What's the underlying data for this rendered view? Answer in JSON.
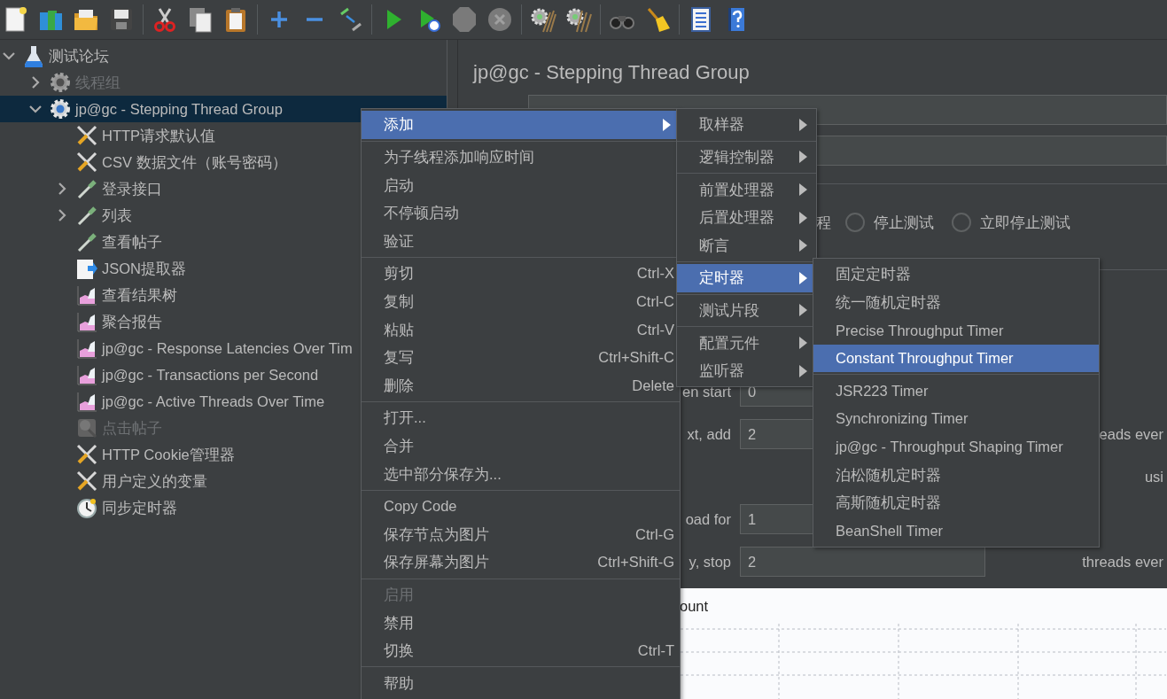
{
  "toolbar": [
    {
      "kind": "new",
      "enabled": true
    },
    {
      "kind": "templates",
      "enabled": true
    },
    {
      "kind": "open",
      "enabled": true
    },
    {
      "kind": "save",
      "enabled": true
    },
    {
      "kind": "separator"
    },
    {
      "kind": "cut",
      "enabled": true
    },
    {
      "kind": "copy",
      "enabled": true
    },
    {
      "kind": "paste",
      "enabled": true
    },
    {
      "kind": "separator"
    },
    {
      "kind": "expand",
      "enabled": true
    },
    {
      "kind": "collapse",
      "enabled": true
    },
    {
      "kind": "toggle",
      "enabled": true
    },
    {
      "kind": "separator"
    },
    {
      "kind": "start",
      "enabled": true
    },
    {
      "kind": "start_no_pause",
      "enabled": true
    },
    {
      "kind": "stop",
      "enabled": false
    },
    {
      "kind": "shutdown",
      "enabled": false
    },
    {
      "kind": "separator"
    },
    {
      "kind": "clear",
      "enabled": true
    },
    {
      "kind": "clear_all",
      "enabled": true
    },
    {
      "kind": "separator"
    },
    {
      "kind": "search",
      "enabled": true
    },
    {
      "kind": "reset",
      "enabled": true
    },
    {
      "kind": "separator"
    },
    {
      "kind": "functions",
      "enabled": true
    },
    {
      "kind": "help",
      "enabled": true
    }
  ],
  "tree": [
    {
      "label": "测试论坛",
      "kind": "test_plan",
      "expanded": true,
      "enabled": true,
      "selected": false,
      "children": [
        {
          "label": "线程组",
          "kind": "thread_group",
          "expanded": false,
          "enabled": false,
          "selected": false
        },
        {
          "label": "jp@gc - Stepping Thread Group",
          "kind": "thread_group",
          "expanded": true,
          "enabled": true,
          "selected": true,
          "children": [
            {
              "label": "HTTP请求默认值",
              "kind": "config",
              "enabled": true,
              "selected": false
            },
            {
              "label": "CSV 数据文件（账号密码）",
              "kind": "config",
              "enabled": true,
              "selected": false
            },
            {
              "label": "登录接口",
              "kind": "sampler",
              "expanded": false,
              "enabled": true,
              "selected": false
            },
            {
              "label": "列表",
              "kind": "sampler",
              "expanded": false,
              "enabled": true,
              "selected": false
            },
            {
              "label": "查看帖子",
              "kind": "sampler",
              "enabled": true,
              "selected": false
            },
            {
              "label": "JSON提取器",
              "kind": "extractor",
              "enabled": true,
              "selected": false
            },
            {
              "label": "查看结果树",
              "kind": "listener",
              "enabled": true,
              "selected": false
            },
            {
              "label": "聚合报告",
              "kind": "listener",
              "enabled": true,
              "selected": false
            },
            {
              "label": "jp@gc - Response Latencies Over Tim",
              "kind": "listener",
              "enabled": true,
              "selected": false
            },
            {
              "label": "jp@gc - Transactions per Second",
              "kind": "listener",
              "enabled": true,
              "selected": false
            },
            {
              "label": "jp@gc - Active Threads Over Time",
              "kind": "listener",
              "enabled": true,
              "selected": false
            },
            {
              "label": "点击帖子",
              "kind": "debug",
              "enabled": false,
              "selected": false
            },
            {
              "label": "HTTP Cookie管理器",
              "kind": "config",
              "enabled": true,
              "selected": false
            },
            {
              "label": "用户定义的变量",
              "kind": "config",
              "enabled": true,
              "selected": false
            },
            {
              "label": "同步定时器",
              "kind": "timer",
              "enabled": true,
              "selected": false
            }
          ]
        }
      ]
    }
  ],
  "panel": {
    "title": "jp@gc - Stepping Thread Group",
    "radio_fragment": "程",
    "radios": [
      {
        "label": "停止测试",
        "selected": false
      },
      {
        "label": "立即停止测试",
        "selected": false
      }
    ],
    "rows": [
      {
        "label": "en start",
        "value": "0"
      },
      {
        "label": "xt, add",
        "value": "2",
        "trailing": "eads ever"
      },
      {
        "trailing": "usi"
      },
      {
        "label": "oad for",
        "value": "1"
      },
      {
        "label": "y, stop",
        "value": "2",
        "trailing": "threads ever"
      }
    ],
    "chart_title": "ount"
  },
  "context_menu": {
    "items": [
      {
        "label": "添加",
        "kind": "submenu",
        "enabled": true,
        "selected": true
      },
      {
        "kind": "separator"
      },
      {
        "label": "为子线程添加响应时间",
        "kind": "item",
        "enabled": true,
        "selected": false
      },
      {
        "label": "启动",
        "kind": "item",
        "enabled": true,
        "selected": false
      },
      {
        "label": "不停顿启动",
        "kind": "item",
        "enabled": true,
        "selected": false
      },
      {
        "label": "验证",
        "kind": "item",
        "enabled": true,
        "selected": false
      },
      {
        "kind": "separator"
      },
      {
        "label": "剪切",
        "shortcut": "Ctrl-X",
        "kind": "item",
        "enabled": true,
        "selected": false
      },
      {
        "label": "复制",
        "shortcut": "Ctrl-C",
        "kind": "item",
        "enabled": true,
        "selected": false
      },
      {
        "label": "粘贴",
        "shortcut": "Ctrl-V",
        "kind": "item",
        "enabled": true,
        "selected": false
      },
      {
        "label": "复写",
        "shortcut": "Ctrl+Shift-C",
        "kind": "item",
        "enabled": true,
        "selected": false
      },
      {
        "label": "删除",
        "shortcut": "Delete",
        "kind": "item",
        "enabled": true,
        "selected": false
      },
      {
        "kind": "separator"
      },
      {
        "label": "打开...",
        "kind": "item",
        "enabled": true,
        "selected": false
      },
      {
        "label": "合并",
        "kind": "item",
        "enabled": true,
        "selected": false
      },
      {
        "label": "选中部分保存为...",
        "kind": "item",
        "enabled": true,
        "selected": false
      },
      {
        "kind": "separator"
      },
      {
        "label": "Copy Code",
        "kind": "item",
        "enabled": true,
        "selected": false
      },
      {
        "label": "保存节点为图片",
        "shortcut": "Ctrl-G",
        "kind": "item",
        "enabled": true,
        "selected": false
      },
      {
        "label": "保存屏幕为图片",
        "shortcut": "Ctrl+Shift-G",
        "kind": "item",
        "enabled": true,
        "selected": false
      },
      {
        "kind": "separator"
      },
      {
        "label": "启用",
        "kind": "item",
        "enabled": false,
        "selected": false
      },
      {
        "label": "禁用",
        "kind": "item",
        "enabled": true,
        "selected": false
      },
      {
        "label": "切换",
        "shortcut": "Ctrl-T",
        "kind": "item",
        "enabled": true,
        "selected": false
      },
      {
        "kind": "separator"
      },
      {
        "label": "帮助",
        "kind": "item",
        "enabled": true,
        "selected": false
      }
    ]
  },
  "add_submenu": {
    "items": [
      {
        "label": "取样器",
        "kind": "submenu",
        "enabled": true,
        "selected": false
      },
      {
        "kind": "separator"
      },
      {
        "label": "逻辑控制器",
        "kind": "submenu",
        "enabled": true,
        "selected": false
      },
      {
        "kind": "separator"
      },
      {
        "label": "前置处理器",
        "kind": "submenu",
        "enabled": true,
        "selected": false
      },
      {
        "label": "后置处理器",
        "kind": "submenu",
        "enabled": true,
        "selected": false
      },
      {
        "label": "断言",
        "kind": "submenu",
        "enabled": true,
        "selected": false
      },
      {
        "kind": "separator"
      },
      {
        "label": "定时器",
        "kind": "submenu",
        "enabled": true,
        "selected": true
      },
      {
        "kind": "separator"
      },
      {
        "label": "测试片段",
        "kind": "submenu",
        "enabled": true,
        "selected": false
      },
      {
        "kind": "separator"
      },
      {
        "label": "配置元件",
        "kind": "submenu",
        "enabled": true,
        "selected": false
      },
      {
        "label": "监听器",
        "kind": "submenu",
        "enabled": true,
        "selected": false
      }
    ]
  },
  "timer_submenu": {
    "items": [
      {
        "label": "固定定时器",
        "kind": "item",
        "enabled": true,
        "selected": false
      },
      {
        "label": "统一随机定时器",
        "kind": "item",
        "enabled": true,
        "selected": false
      },
      {
        "label": "Precise Throughput Timer",
        "kind": "item",
        "enabled": true,
        "selected": false
      },
      {
        "label": "Constant Throughput Timer",
        "kind": "item",
        "enabled": true,
        "selected": true
      },
      {
        "kind": "separator"
      },
      {
        "label": "JSR223 Timer",
        "kind": "item",
        "enabled": true,
        "selected": false
      },
      {
        "label": "Synchronizing Timer",
        "kind": "item",
        "enabled": true,
        "selected": false
      },
      {
        "label": "jp@gc - Throughput Shaping Timer",
        "kind": "item",
        "enabled": true,
        "selected": false
      },
      {
        "label": "泊松随机定时器",
        "kind": "item",
        "enabled": true,
        "selected": false
      },
      {
        "label": "高斯随机定时器",
        "kind": "item",
        "enabled": true,
        "selected": false
      },
      {
        "label": "BeanShell Timer",
        "kind": "item",
        "enabled": true,
        "selected": false
      }
    ]
  }
}
